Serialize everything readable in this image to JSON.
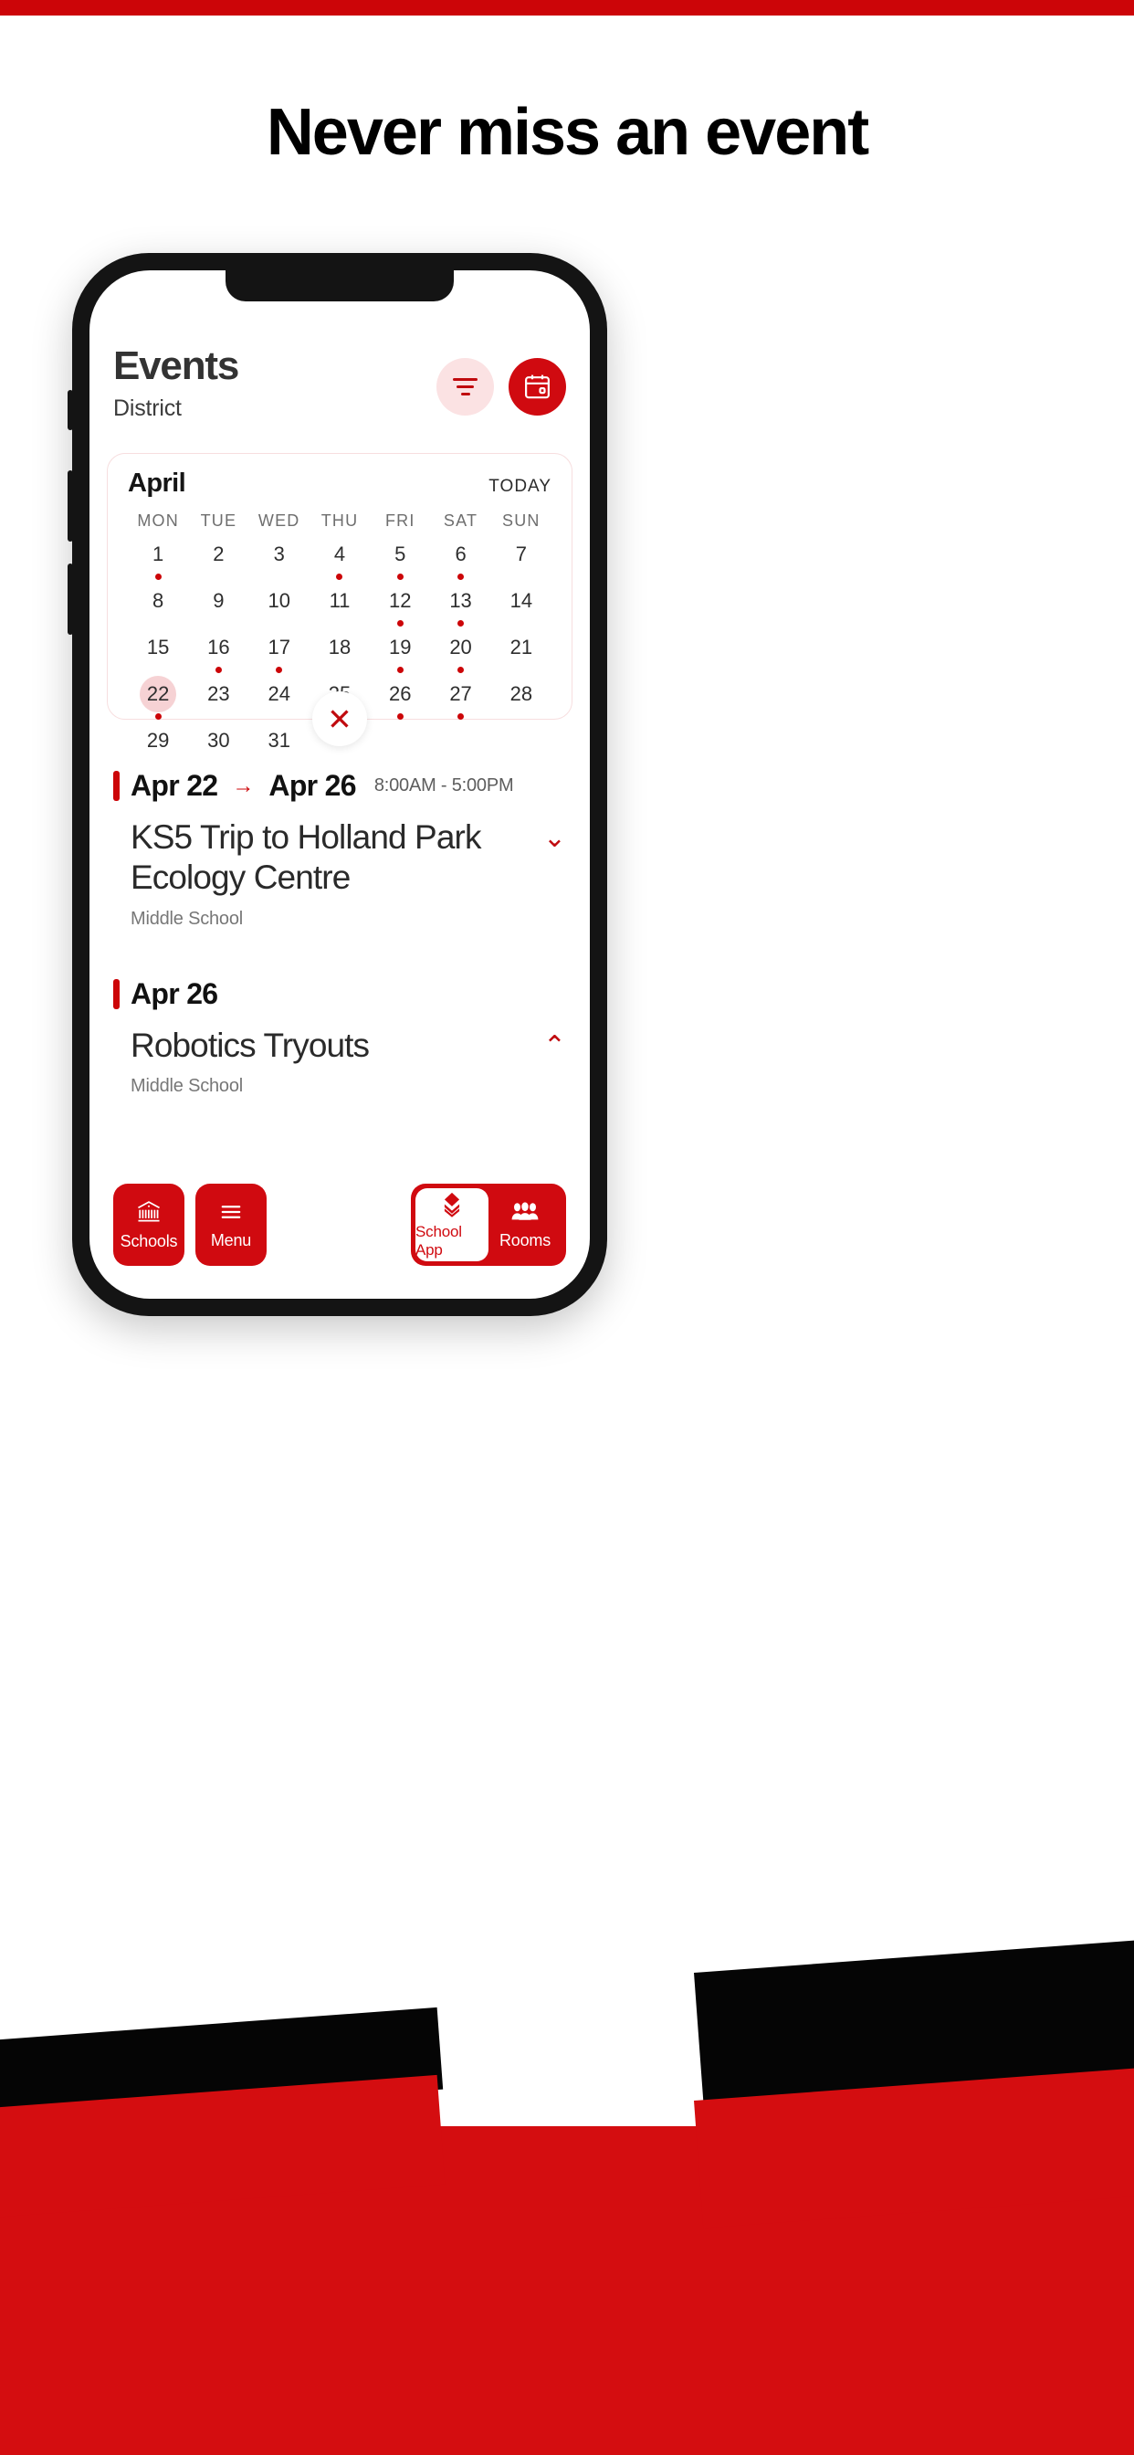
{
  "headline": "Never miss an event",
  "colors": {
    "brand_red": "#cc0508",
    "accent_red": "#d00a10",
    "pale_pink": "#fbe2e3",
    "selected_pink": "#f6d2d4"
  },
  "app": {
    "title": "Events",
    "subtitle": "District",
    "filter_icon": "filter-icon",
    "calendar_icon": "calendar-icon"
  },
  "calendar": {
    "month": "April",
    "today_label": "TODAY",
    "weekdays": [
      "MON",
      "TUE",
      "WED",
      "THU",
      "FRI",
      "SAT",
      "SUN"
    ],
    "close_label": "✕",
    "days": [
      {
        "n": "1",
        "dot": true
      },
      {
        "n": "2",
        "dot": false
      },
      {
        "n": "3",
        "dot": false
      },
      {
        "n": "4",
        "dot": true
      },
      {
        "n": "5",
        "dot": true
      },
      {
        "n": "6",
        "dot": true
      },
      {
        "n": "7",
        "dot": false
      },
      {
        "n": "8",
        "dot": false
      },
      {
        "n": "9",
        "dot": false
      },
      {
        "n": "10",
        "dot": false
      },
      {
        "n": "11",
        "dot": false
      },
      {
        "n": "12",
        "dot": true
      },
      {
        "n": "13",
        "dot": true
      },
      {
        "n": "14",
        "dot": false
      },
      {
        "n": "15",
        "dot": false
      },
      {
        "n": "16",
        "dot": true
      },
      {
        "n": "17",
        "dot": true
      },
      {
        "n": "18",
        "dot": false
      },
      {
        "n": "19",
        "dot": true
      },
      {
        "n": "20",
        "dot": true
      },
      {
        "n": "21",
        "dot": false
      },
      {
        "n": "22",
        "dot": true,
        "selected": true
      },
      {
        "n": "23",
        "dot": false
      },
      {
        "n": "24",
        "dot": false
      },
      {
        "n": "25",
        "dot": false
      },
      {
        "n": "26",
        "dot": true
      },
      {
        "n": "27",
        "dot": true
      },
      {
        "n": "28",
        "dot": false
      },
      {
        "n": "29",
        "dot": false
      },
      {
        "n": "30",
        "dot": false
      },
      {
        "n": "31",
        "dot": false
      }
    ]
  },
  "events": [
    {
      "date_start": "Apr 22",
      "arrow": "→",
      "date_end": "Apr 26",
      "time": "8:00AM  -  5:00PM",
      "title": "KS5 Trip to Holland Park Ecology Centre",
      "org": "Middle School",
      "chevron": "⌄",
      "expanded": false
    },
    {
      "date_start": "Apr 26",
      "arrow": "",
      "date_end": "",
      "time": "",
      "title": "Robotics Tryouts",
      "org": "Middle School",
      "chevron": "⌃",
      "expanded": true
    }
  ],
  "bottom_nav": {
    "left": [
      {
        "label": "Schools",
        "icon": "school-building-icon"
      },
      {
        "label": "Menu",
        "icon": "hamburger-menu-icon"
      }
    ],
    "right": [
      {
        "label": "School App",
        "icon": "layers-icon",
        "active": true
      },
      {
        "label": "Rooms",
        "icon": "people-group-icon",
        "active": false
      }
    ]
  }
}
